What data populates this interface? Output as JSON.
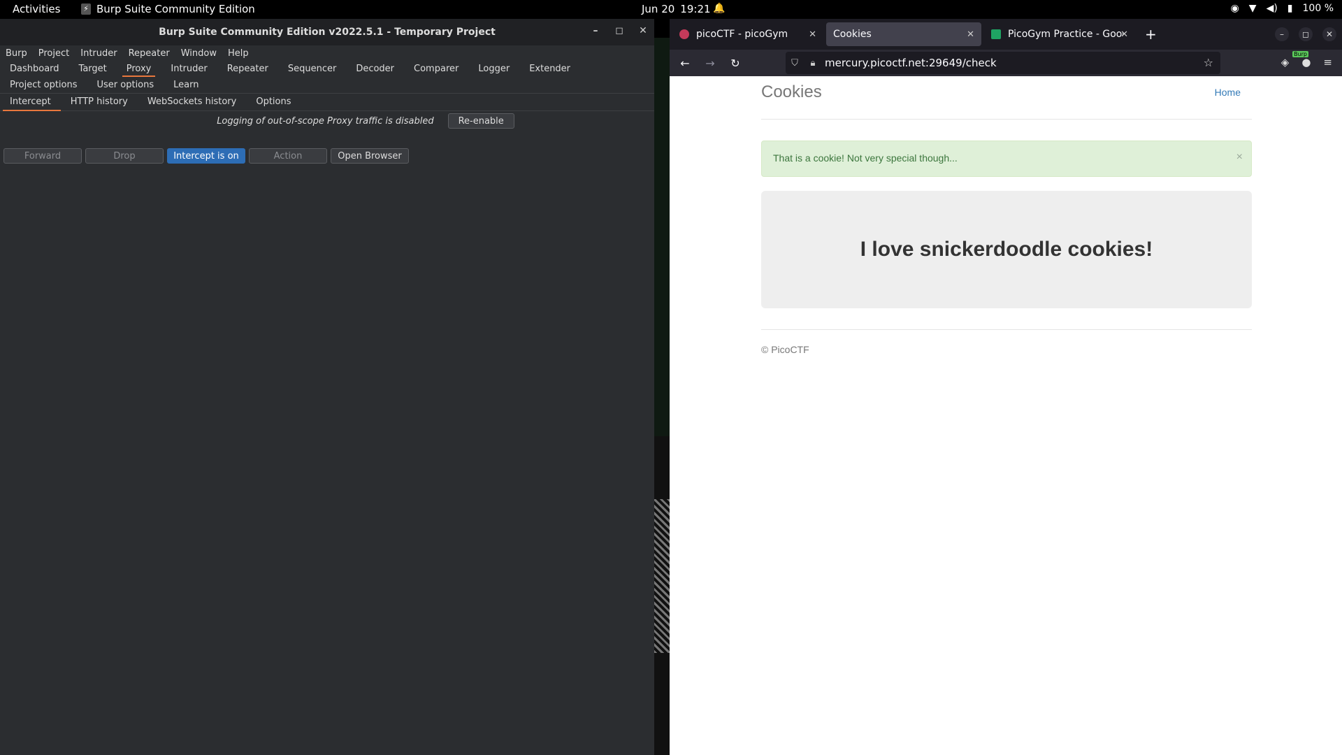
{
  "topbar": {
    "activities": "Activities",
    "app_name": "Burp Suite Community Edition",
    "date": "Jun 20",
    "time": "19:21",
    "battery": "100 %"
  },
  "burp": {
    "title": "Burp Suite Community Edition v2022.5.1 - Temporary Project",
    "menu": [
      "Burp",
      "Project",
      "Intruder",
      "Repeater",
      "Window",
      "Help"
    ],
    "tabs": [
      "Dashboard",
      "Target",
      "Proxy",
      "Intruder",
      "Repeater",
      "Sequencer",
      "Decoder",
      "Comparer",
      "Logger",
      "Extender",
      "Project options",
      "User options",
      "Learn"
    ],
    "active_tab": "Proxy",
    "subtabs": [
      "Intercept",
      "HTTP history",
      "WebSockets history",
      "Options"
    ],
    "active_subtab": "Intercept",
    "log_message": "Logging of out-of-scope Proxy traffic is disabled",
    "reenable_label": "Re-enable",
    "actions": {
      "forward": "Forward",
      "drop": "Drop",
      "intercept": "Intercept is on",
      "action": "Action",
      "open_browser": "Open Browser"
    }
  },
  "firefox": {
    "tabs": [
      {
        "title": "picoCTF - picoGym",
        "active": false
      },
      {
        "title": "Cookies",
        "active": true
      },
      {
        "title": "PicoGym Practice - Googl",
        "active": false
      }
    ],
    "url": "mercury.picoctf.net:29649/check",
    "burp_badge": "Burp"
  },
  "page": {
    "heading": "Cookies",
    "home_link": "Home",
    "alert": "That is a cookie! Not very special though...",
    "alert_close": "×",
    "jumbotron": "I love snickerdoodle cookies!",
    "footer": "© PicoCTF"
  },
  "colors": {
    "burp_bg": "#2b2d30",
    "accent_orange": "#e8773d",
    "intercept_blue": "#2d6db5",
    "alert_green_bg": "#dff0d8",
    "link_blue": "#337ab7"
  }
}
